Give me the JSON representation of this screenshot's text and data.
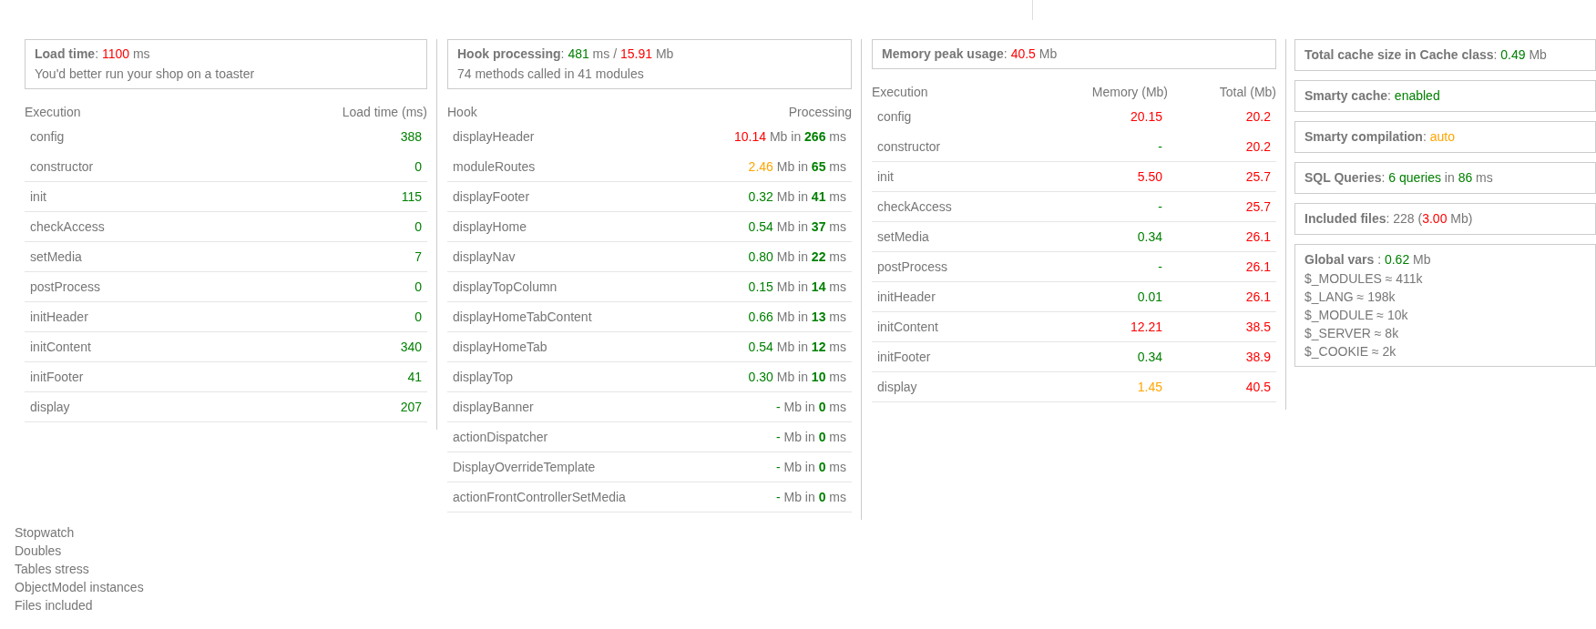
{
  "panels": [
    {
      "summary": {
        "label": "Load time",
        "parts": [
          {
            "text": ": "
          },
          {
            "text": "1100",
            "color": "#ff0000"
          },
          {
            "text": " ms"
          }
        ]
      },
      "note": "You'd better run your shop on a toaster",
      "table": {
        "columns": [
          "Execution",
          "Load time (ms)"
        ],
        "rows": [
          {
            "cells": [
              [
                {
                  "text": "config"
                }
              ],
              [
                {
                  "text": "388",
                  "color": "#008000"
                }
              ]
            ]
          },
          {
            "cells": [
              [
                {
                  "text": "constructor"
                }
              ],
              [
                {
                  "text": "0",
                  "color": "#008000"
                }
              ]
            ]
          },
          {
            "cells": [
              [
                {
                  "text": "init"
                }
              ],
              [
                {
                  "text": "115",
                  "color": "#008000"
                }
              ]
            ]
          },
          {
            "cells": [
              [
                {
                  "text": "checkAccess"
                }
              ],
              [
                {
                  "text": "0",
                  "color": "#008000"
                }
              ]
            ]
          },
          {
            "cells": [
              [
                {
                  "text": "setMedia"
                }
              ],
              [
                {
                  "text": "7",
                  "color": "#008000"
                }
              ]
            ]
          },
          {
            "cells": [
              [
                {
                  "text": "postProcess"
                }
              ],
              [
                {
                  "text": "0",
                  "color": "#008000"
                }
              ]
            ]
          },
          {
            "cells": [
              [
                {
                  "text": "initHeader"
                }
              ],
              [
                {
                  "text": "0",
                  "color": "#008000"
                }
              ]
            ]
          },
          {
            "cells": [
              [
                {
                  "text": "initContent"
                }
              ],
              [
                {
                  "text": "340",
                  "color": "#008000"
                }
              ]
            ]
          },
          {
            "cells": [
              [
                {
                  "text": "initFooter"
                }
              ],
              [
                {
                  "text": "41",
                  "color": "#008000"
                }
              ]
            ]
          },
          {
            "cells": [
              [
                {
                  "text": "display"
                }
              ],
              [
                {
                  "text": "207",
                  "color": "#008000"
                }
              ]
            ]
          }
        ]
      }
    },
    {
      "summary": {
        "label": "Hook processing",
        "parts": [
          {
            "text": ": "
          },
          {
            "text": "481",
            "color": "#008000"
          },
          {
            "text": " ms / "
          },
          {
            "text": "15.91",
            "color": "#ff0000"
          },
          {
            "text": " Mb"
          }
        ]
      },
      "note": "74 methods called in 41 modules",
      "table": {
        "columns": [
          "Hook",
          "Processing"
        ],
        "rows": [
          {
            "cells": [
              [
                {
                  "text": "displayHeader"
                }
              ],
              [
                {
                  "text": "10.14",
                  "color": "#ff0000"
                },
                {
                  "text": " Mb in "
                },
                {
                  "text": "266",
                  "color": "#008000",
                  "bold": true
                },
                {
                  "text": " ms"
                }
              ]
            ]
          },
          {
            "cells": [
              [
                {
                  "text": "moduleRoutes"
                }
              ],
              [
                {
                  "text": "2.46",
                  "color": "#ffa500"
                },
                {
                  "text": " Mb in "
                },
                {
                  "text": "65",
                  "color": "#008000",
                  "bold": true
                },
                {
                  "text": " ms"
                }
              ]
            ]
          },
          {
            "cells": [
              [
                {
                  "text": "displayFooter"
                }
              ],
              [
                {
                  "text": "0.32",
                  "color": "#008000"
                },
                {
                  "text": " Mb in "
                },
                {
                  "text": "41",
                  "color": "#008000",
                  "bold": true
                },
                {
                  "text": " ms"
                }
              ]
            ]
          },
          {
            "cells": [
              [
                {
                  "text": "displayHome"
                }
              ],
              [
                {
                  "text": "0.54",
                  "color": "#008000"
                },
                {
                  "text": " Mb in "
                },
                {
                  "text": "37",
                  "color": "#008000",
                  "bold": true
                },
                {
                  "text": " ms"
                }
              ]
            ]
          },
          {
            "cells": [
              [
                {
                  "text": "displayNav"
                }
              ],
              [
                {
                  "text": "0.80",
                  "color": "#008000"
                },
                {
                  "text": " Mb in "
                },
                {
                  "text": "22",
                  "color": "#008000",
                  "bold": true
                },
                {
                  "text": " ms"
                }
              ]
            ]
          },
          {
            "cells": [
              [
                {
                  "text": "displayTopColumn"
                }
              ],
              [
                {
                  "text": "0.15",
                  "color": "#008000"
                },
                {
                  "text": " Mb in "
                },
                {
                  "text": "14",
                  "color": "#008000",
                  "bold": true
                },
                {
                  "text": " ms"
                }
              ]
            ]
          },
          {
            "cells": [
              [
                {
                  "text": "displayHomeTabContent"
                }
              ],
              [
                {
                  "text": "0.66",
                  "color": "#008000"
                },
                {
                  "text": " Mb in "
                },
                {
                  "text": "13",
                  "color": "#008000",
                  "bold": true
                },
                {
                  "text": " ms"
                }
              ]
            ]
          },
          {
            "cells": [
              [
                {
                  "text": "displayHomeTab"
                }
              ],
              [
                {
                  "text": "0.54",
                  "color": "#008000"
                },
                {
                  "text": " Mb in "
                },
                {
                  "text": "12",
                  "color": "#008000",
                  "bold": true
                },
                {
                  "text": " ms"
                }
              ]
            ]
          },
          {
            "cells": [
              [
                {
                  "text": "displayTop"
                }
              ],
              [
                {
                  "text": "0.30",
                  "color": "#008000"
                },
                {
                  "text": " Mb in "
                },
                {
                  "text": "10",
                  "color": "#008000",
                  "bold": true
                },
                {
                  "text": " ms"
                }
              ]
            ]
          },
          {
            "cells": [
              [
                {
                  "text": "displayBanner"
                }
              ],
              [
                {
                  "text": "-",
                  "color": "#008000"
                },
                {
                  "text": " Mb in "
                },
                {
                  "text": "0",
                  "color": "#008000",
                  "bold": true
                },
                {
                  "text": " ms"
                }
              ]
            ]
          },
          {
            "cells": [
              [
                {
                  "text": "actionDispatcher"
                }
              ],
              [
                {
                  "text": "-",
                  "color": "#008000"
                },
                {
                  "text": " Mb in "
                },
                {
                  "text": "0",
                  "color": "#008000",
                  "bold": true
                },
                {
                  "text": " ms"
                }
              ]
            ]
          },
          {
            "cells": [
              [
                {
                  "text": "DisplayOverrideTemplate"
                }
              ],
              [
                {
                  "text": "-",
                  "color": "#008000"
                },
                {
                  "text": " Mb in "
                },
                {
                  "text": "0",
                  "color": "#008000",
                  "bold": true
                },
                {
                  "text": " ms"
                }
              ]
            ]
          },
          {
            "cells": [
              [
                {
                  "text": "actionFrontControllerSetMedia"
                }
              ],
              [
                {
                  "text": "-",
                  "color": "#008000"
                },
                {
                  "text": " Mb in "
                },
                {
                  "text": "0",
                  "color": "#008000",
                  "bold": true
                },
                {
                  "text": " ms"
                }
              ]
            ]
          }
        ]
      }
    },
    {
      "summary": {
        "label": "Memory peak usage",
        "parts": [
          {
            "text": ": "
          },
          {
            "text": "40.5",
            "color": "#ff0000"
          },
          {
            "text": " Mb"
          }
        ]
      },
      "table": {
        "columns": [
          "Execution",
          "Memory (Mb)",
          "Total (Mb)"
        ],
        "rows": [
          {
            "cells": [
              [
                {
                  "text": "config"
                }
              ],
              [
                {
                  "text": "20.15",
                  "color": "#ff0000"
                }
              ],
              [
                {
                  "text": "20.2",
                  "color": "#ff0000"
                }
              ]
            ]
          },
          {
            "cells": [
              [
                {
                  "text": "constructor"
                }
              ],
              [
                {
                  "text": "-",
                  "color": "#008000"
                }
              ],
              [
                {
                  "text": "20.2",
                  "color": "#ff0000"
                }
              ]
            ]
          },
          {
            "cells": [
              [
                {
                  "text": "init"
                }
              ],
              [
                {
                  "text": "5.50",
                  "color": "#ff0000"
                }
              ],
              [
                {
                  "text": "25.7",
                  "color": "#ff0000"
                }
              ]
            ]
          },
          {
            "cells": [
              [
                {
                  "text": "checkAccess"
                }
              ],
              [
                {
                  "text": "-",
                  "color": "#008000"
                }
              ],
              [
                {
                  "text": "25.7",
                  "color": "#ff0000"
                }
              ]
            ]
          },
          {
            "cells": [
              [
                {
                  "text": "setMedia"
                }
              ],
              [
                {
                  "text": "0.34",
                  "color": "#008000"
                }
              ],
              [
                {
                  "text": "26.1",
                  "color": "#ff0000"
                }
              ]
            ]
          },
          {
            "cells": [
              [
                {
                  "text": "postProcess"
                }
              ],
              [
                {
                  "text": "-",
                  "color": "#008000"
                }
              ],
              [
                {
                  "text": "26.1",
                  "color": "#ff0000"
                }
              ]
            ]
          },
          {
            "cells": [
              [
                {
                  "text": "initHeader"
                }
              ],
              [
                {
                  "text": "0.01",
                  "color": "#008000"
                }
              ],
              [
                {
                  "text": "26.1",
                  "color": "#ff0000"
                }
              ]
            ]
          },
          {
            "cells": [
              [
                {
                  "text": "initContent"
                }
              ],
              [
                {
                  "text": "12.21",
                  "color": "#ff0000"
                }
              ],
              [
                {
                  "text": "38.5",
                  "color": "#ff0000"
                }
              ]
            ]
          },
          {
            "cells": [
              [
                {
                  "text": "initFooter"
                }
              ],
              [
                {
                  "text": "0.34",
                  "color": "#008000"
                }
              ],
              [
                {
                  "text": "38.9",
                  "color": "#ff0000"
                }
              ]
            ]
          },
          {
            "cells": [
              [
                {
                  "text": "display"
                }
              ],
              [
                {
                  "text": "1.45",
                  "color": "#ffa500"
                }
              ],
              [
                {
                  "text": "40.5",
                  "color": "#ff0000"
                }
              ]
            ]
          }
        ]
      }
    }
  ],
  "info_boxes": [
    {
      "label": "Total cache size in Cache class",
      "parts": [
        {
          "text": ": "
        },
        {
          "text": "0.49",
          "color": "#008000"
        },
        {
          "text": " Mb"
        }
      ]
    },
    {
      "label": "Smarty cache",
      "parts": [
        {
          "text": ": "
        },
        {
          "text": "enabled",
          "color": "#008000"
        }
      ]
    },
    {
      "label": "Smarty compilation",
      "parts": [
        {
          "text": ": "
        },
        {
          "text": "auto",
          "color": "#ffa500"
        }
      ]
    },
    {
      "label": "SQL Queries",
      "parts": [
        {
          "text": ": "
        },
        {
          "text": "6 queries",
          "color": "#008000"
        },
        {
          "text": " in "
        },
        {
          "text": "86",
          "color": "#008000"
        },
        {
          "text": " ms"
        }
      ]
    },
    {
      "label": "Included files",
      "parts": [
        {
          "text": ": 228 ("
        },
        {
          "text": "3.00",
          "color": "#ff0000"
        },
        {
          "text": " Mb)"
        }
      ]
    },
    {
      "label": "Global vars",
      "parts": [
        {
          "text": " : "
        },
        {
          "text": "0.62",
          "color": "#008000"
        },
        {
          "text": " Mb"
        }
      ],
      "lines": [
        "$_MODULES ≈ 411k",
        "$_LANG ≈ 198k",
        "$_MODULE ≈ 10k",
        "$_SERVER ≈ 8k",
        "$_COOKIE ≈ 2k"
      ]
    }
  ],
  "links": [
    "Stopwatch",
    "Doubles",
    "Tables stress",
    "ObjectModel instances",
    "Files included"
  ]
}
